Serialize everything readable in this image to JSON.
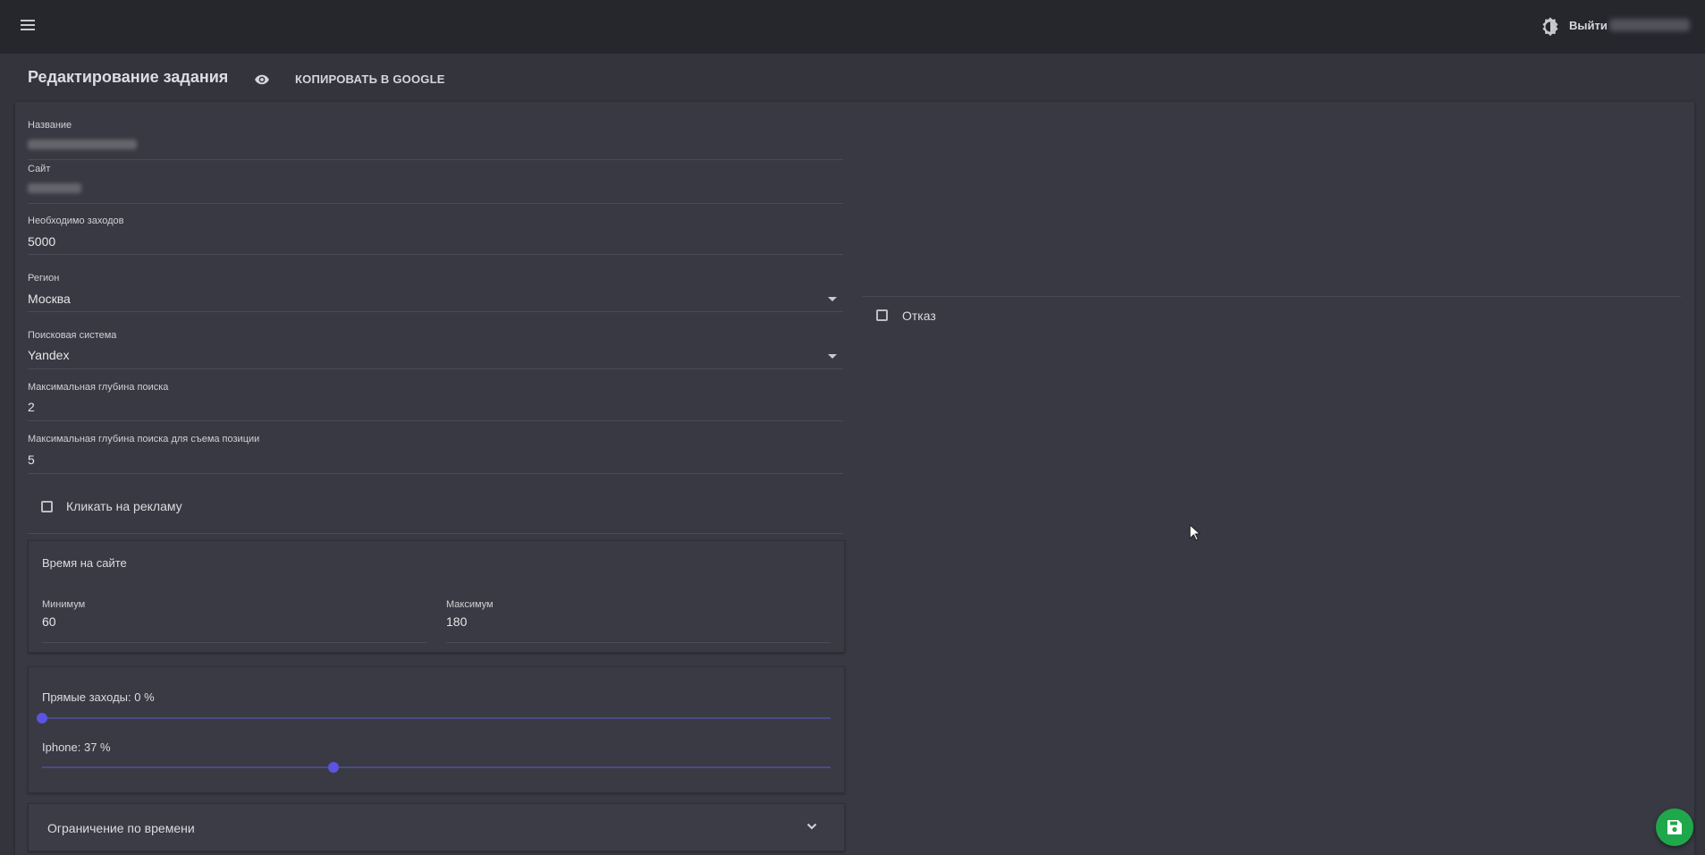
{
  "header": {
    "logout_label": "Выйти"
  },
  "page": {
    "title": "Редактирование задания",
    "copy_label": "КОПИРОВАТЬ В GOOGLE"
  },
  "form": {
    "name": {
      "label": "Название"
    },
    "site": {
      "label": "Сайт"
    },
    "visits": {
      "label": "Необходимо заходов",
      "value": "5000"
    },
    "region": {
      "label": "Регион",
      "value": "Москва"
    },
    "search_engine": {
      "label": "Поисковая система",
      "value": "Yandex"
    },
    "max_depth": {
      "label": "Максимальная глубина поиска",
      "value": "2"
    },
    "max_depth_position": {
      "label": "Максимальная глубина поиска для съема позиции",
      "value": "5"
    },
    "click_ads": {
      "label": "Кликать на рекламу",
      "checked": false
    },
    "time_on_site": {
      "title": "Время на сайте",
      "min_label": "Минимум",
      "min_value": "60",
      "max_label": "Максимум",
      "max_value": "180"
    },
    "sliders": {
      "direct": {
        "label": "Прямые заходы: 0 %",
        "value": 0
      },
      "iphone": {
        "label": "Iphone: 37 %",
        "value": 37
      }
    },
    "time_limit": {
      "label": "Ограничение по времени"
    }
  },
  "right": {
    "refusal": {
      "label": "Отказ",
      "checked": false
    }
  },
  "colors": {
    "accent": "#5b54e0",
    "fab": "#1fa84b",
    "background": "#33343c",
    "topbar": "#26272d"
  },
  "icons": [
    "menu-icon",
    "theme-icon",
    "eye-icon",
    "chevron-down-icon",
    "save-icon",
    "caret-down-icon",
    "cursor-icon"
  ]
}
